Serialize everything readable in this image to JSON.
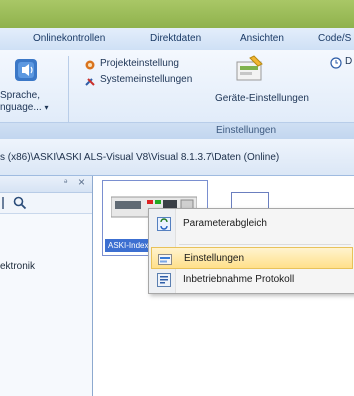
{
  "menu": {
    "tabs": [
      "Onlinekontrollen",
      "Direktdaten",
      "Ansichten",
      "Code/S"
    ]
  },
  "ribbon": {
    "sprache_line1": "Sprache,",
    "sprache_line2": "nguage...",
    "sprache_arrow": "▾",
    "projekt": "Projekteinstellung",
    "system": "Systemeinstellungen",
    "geraete": "Geräte-Einstellungen",
    "d_item": "D",
    "group_label": "Einstellungen"
  },
  "path": {
    "text": "s (x86)\\ASKI\\ASKI ALS-Visual V8\\Visual 8.1.3.7\\Daten (Online)"
  },
  "leftpanel": {
    "pin": "ᵊ",
    "close": "×",
    "item": "ektronik"
  },
  "device": {
    "label": "ASKI-Index"
  },
  "context_menu": {
    "items": [
      {
        "label": "Parameterabgleich",
        "icon": "sync-icon"
      },
      {
        "label": "Einstellungen",
        "icon": "settings-icon"
      },
      {
        "label": "Inbetriebnahme Protokoll",
        "icon": "report-icon"
      }
    ],
    "highlight_color": "#ffe08a"
  },
  "colors": {
    "titlebar": "#9cbb58",
    "accent": "#3c6fd1"
  }
}
